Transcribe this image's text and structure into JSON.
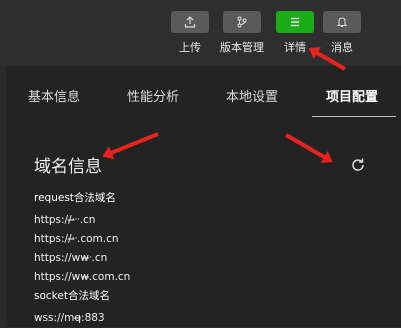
{
  "toolbar": {
    "upload_label": "上传",
    "version_label": "版本管理",
    "details_label": "详情",
    "news_label": "消息",
    "active_color": "#1aad19",
    "icons": [
      "upload-icon",
      "branch-icon",
      "menu-icon",
      "bell-icon"
    ]
  },
  "tabs": {
    "basic": "基本信息",
    "performance": "性能分析",
    "local": "本地设置",
    "project": "项目配置"
  },
  "main": {
    "title": "域名信息",
    "request_header": "request合法域名",
    "request_domains": [
      "https://ᐧ̶̶̶ᐧᐧ.cn",
      "https://ᐧ̶̶̶ᐧ.com.cn",
      "https://ww̶̶̶̶ᐧ.cn",
      "https://ww̶̶̶̶.com.cn"
    ],
    "socket_header": "socket合法域名",
    "socket_domains": [
      "wss://mq̶̶̶̶̶̶̶̶̶:883"
    ]
  },
  "annotations": {
    "arrow_color": "#e8231d"
  }
}
